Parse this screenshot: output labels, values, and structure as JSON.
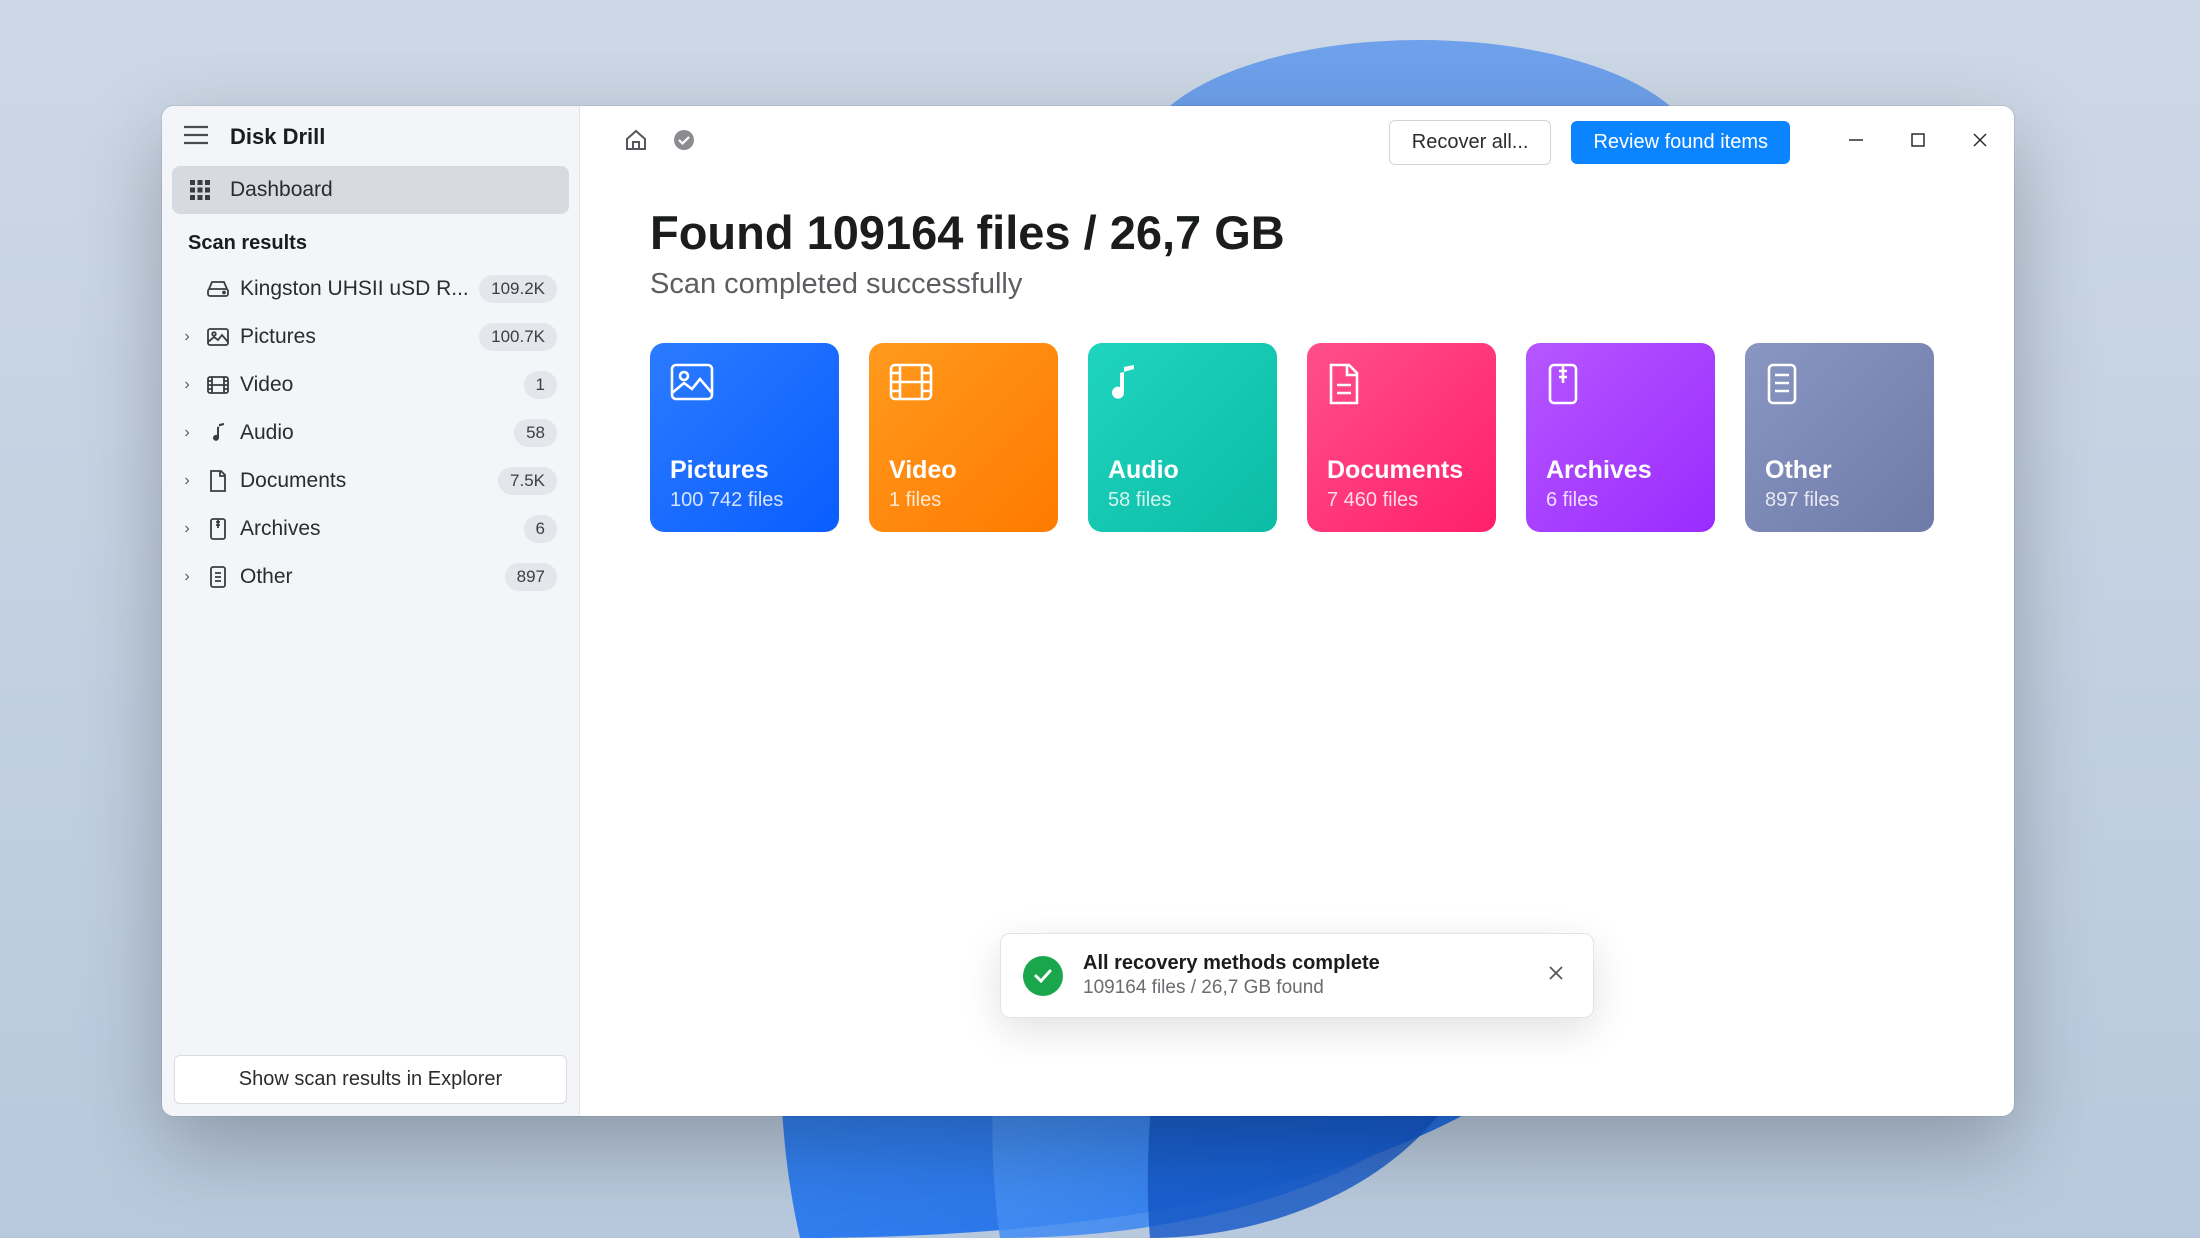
{
  "app": {
    "title": "Disk Drill"
  },
  "sidebar": {
    "dashboard_label": "Dashboard",
    "section_label": "Scan results",
    "drive": {
      "name": "Kingston UHSII uSD R...",
      "count": "109.2K"
    },
    "items": [
      {
        "label": "Pictures",
        "count": "100.7K"
      },
      {
        "label": "Video",
        "count": "1"
      },
      {
        "label": "Audio",
        "count": "58"
      },
      {
        "label": "Documents",
        "count": "7.5K"
      },
      {
        "label": "Archives",
        "count": "6"
      },
      {
        "label": "Other",
        "count": "897"
      }
    ],
    "explorer_button": "Show scan results in Explorer"
  },
  "toolbar": {
    "recover_label": "Recover all...",
    "review_label": "Review found items"
  },
  "main": {
    "headline": "Found 109164 files / 26,7 GB",
    "subhead": "Scan completed successfully"
  },
  "cards": [
    {
      "title": "Pictures",
      "sub": "100 742 files"
    },
    {
      "title": "Video",
      "sub": "1 files"
    },
    {
      "title": "Audio",
      "sub": "58 files"
    },
    {
      "title": "Documents",
      "sub": "7 460 files"
    },
    {
      "title": "Archives",
      "sub": "6 files"
    },
    {
      "title": "Other",
      "sub": "897 files"
    }
  ],
  "toast": {
    "title": "All recovery methods complete",
    "sub": "109164 files / 26,7 GB found"
  },
  "colors": {
    "accent": "#0a84ff"
  }
}
